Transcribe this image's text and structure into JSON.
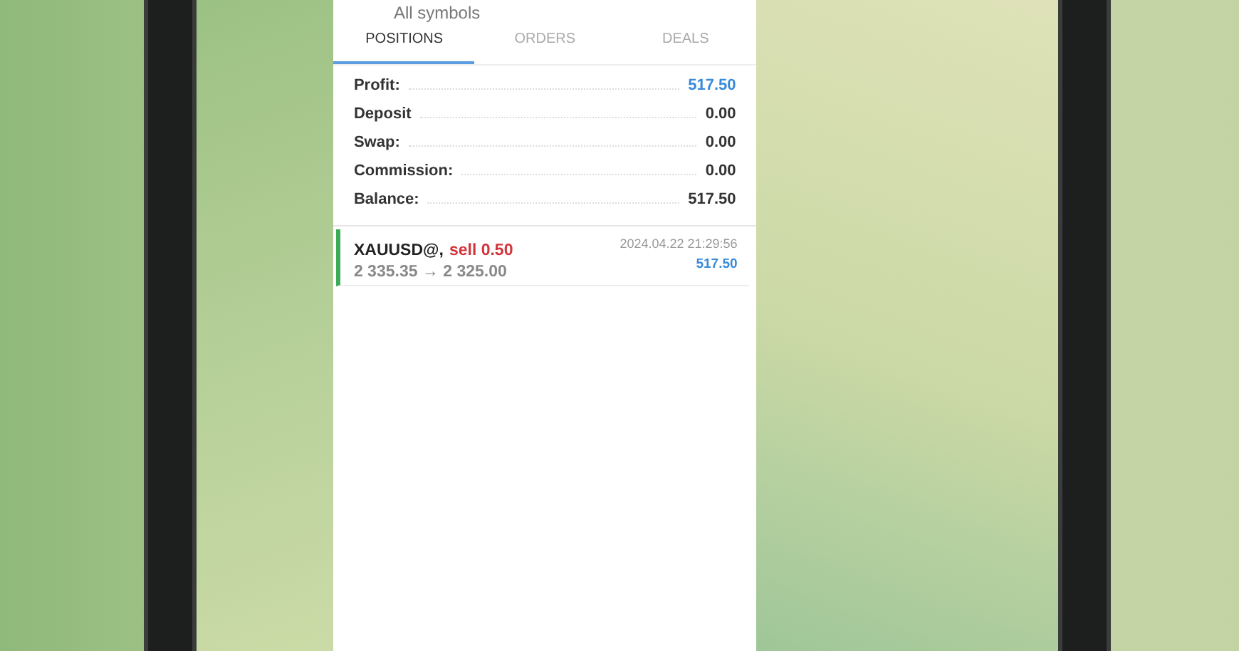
{
  "header": {
    "subtitle": "All symbols"
  },
  "tabs": [
    {
      "label": "POSITIONS",
      "selected": true
    },
    {
      "label": "ORDERS",
      "selected": false
    },
    {
      "label": "DEALS",
      "selected": false
    }
  ],
  "summary": [
    {
      "label": "Profit:",
      "value": "517.50",
      "kind": "gain"
    },
    {
      "label": "Deposit",
      "value": "0.00",
      "kind": "plain"
    },
    {
      "label": "Swap:",
      "value": "0.00",
      "kind": "plain"
    },
    {
      "label": "Commission:",
      "value": "0.00",
      "kind": "plain"
    },
    {
      "label": "Balance:",
      "value": "517.50",
      "kind": "plain"
    }
  ],
  "positions": [
    {
      "symbol": "XAUUSD@,",
      "side": "sell 0.50",
      "kind": "sell",
      "prices": "2 335.35 → 2 325.00",
      "time": "2024.04.22 21:29:56",
      "profit": "517.50"
    }
  ]
}
